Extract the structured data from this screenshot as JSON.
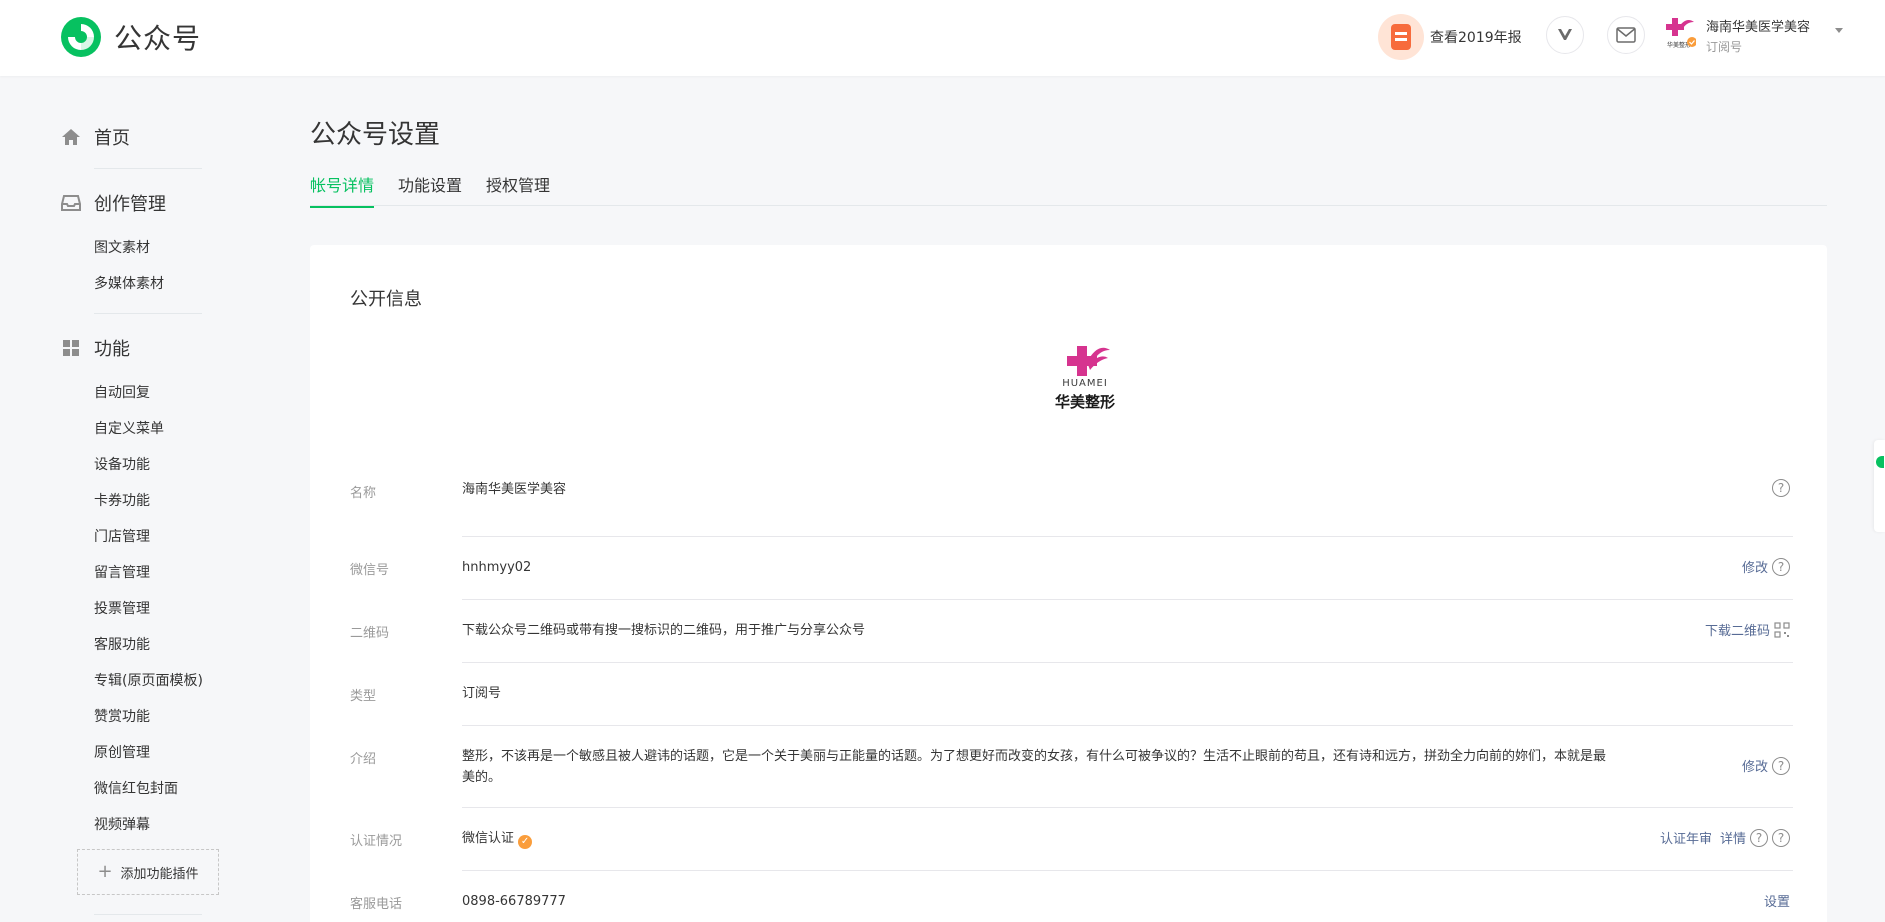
{
  "header": {
    "brand": "公众号",
    "report_label": "查看2019年报",
    "account_name": "海南华美医学美容",
    "account_type": "订阅号",
    "avatar_caption": "华美整形"
  },
  "sidebar": {
    "home": "首页",
    "create": {
      "label": "创作管理",
      "items": [
        "图文素材",
        "多媒体素材"
      ]
    },
    "features": {
      "label": "功能",
      "items": [
        "自动回复",
        "自定义菜单",
        "设备功能",
        "卡券功能",
        "门店管理",
        "留言管理",
        "投票管理",
        "客服功能",
        "专辑(原页面模板)",
        "赞赏功能",
        "原创管理",
        "微信红包封面",
        "视频弹幕"
      ]
    },
    "add_plugin": "添加功能插件"
  },
  "page": {
    "title": "公众号设置",
    "tabs": [
      "帐号详情",
      "功能设置",
      "授权管理"
    ]
  },
  "card": {
    "title": "公开信息",
    "brand_en": "HUAMEI",
    "brand_cn": "华美整形",
    "rows": {
      "name": {
        "label": "名称",
        "value": "海南华美医学美容"
      },
      "wechat_id": {
        "label": "微信号",
        "value": "hnhmyy02",
        "action": "修改"
      },
      "qrcode": {
        "label": "二维码",
        "value": "下载公众号二维码或带有搜一搜标识的二维码，用于推广与分享公众号",
        "action": "下载二维码"
      },
      "type": {
        "label": "类型",
        "value": "订阅号"
      },
      "intro": {
        "label": "介绍",
        "value": "整形，不该再是一个敏感且被人避讳的话题，它是一个关于美丽与正能量的话题。为了想更好而改变的女孩，有什么可被争议的？生活不止眼前的苟且，还有诗和远方，拼劲全力向前的妳们，本就是最美的。",
        "action": "修改"
      },
      "verify": {
        "label": "认证情况",
        "value": "微信认证",
        "action1": "认证年审",
        "action2": "详情"
      },
      "phone": {
        "label": "客服电话",
        "value": "0898-66789777",
        "action": "设置"
      }
    }
  },
  "colors": {
    "accent": "#07c160",
    "link": "#576b95",
    "brand_pink": "#d6348f"
  }
}
